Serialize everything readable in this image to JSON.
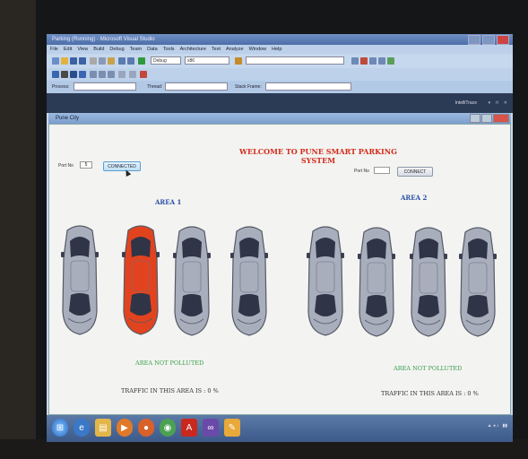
{
  "vs": {
    "title": "Parking (Running) - Microsoft Visual Studio",
    "menu": [
      "File",
      "Edit",
      "View",
      "Build",
      "Debug",
      "Team",
      "Data",
      "Tools",
      "Architecture",
      "Test",
      "Analyze",
      "Window",
      "Help"
    ],
    "config_value": "Debug",
    "platform_value": "x86",
    "process_label": "Process:",
    "thread_label": "Thread:",
    "stack_frame_label": "Stack Frame:",
    "intellitrace_label": "IntelliTrace"
  },
  "app": {
    "window_title": "Pune City",
    "welcome": "WELCOME TO PUNE SMART PARKING SYSTEM",
    "left_port_label": "Port No",
    "left_port_value": "5",
    "left_connect_label": "CONNECTED",
    "right_port_label": "Port No",
    "right_port_value": "",
    "right_connect_label": "CONNECT",
    "area1": {
      "title": "AREA 1",
      "status": "AREA NOT POLLUTED",
      "traffic": "TRAFFIC IN THIS AREA IS : 0 %",
      "slots": [
        "empty",
        "occupied",
        "empty",
        "empty"
      ]
    },
    "area2": {
      "title": "AREA 2",
      "status": "AREA NOT POLLUTED",
      "traffic": "TRAFFIC IN THIS AREA IS : 0 %",
      "slots": [
        "empty",
        "empty",
        "empty",
        "empty"
      ]
    }
  },
  "colors": {
    "car_empty": "#a9aebd",
    "car_occupied": "#e2431f",
    "welcome": "#d22b1a",
    "area_title": "#2a4fa8",
    "status_ok": "#3aa04a"
  },
  "taskbar": {
    "items": [
      "start-orb-icon",
      "ie-icon",
      "explorer-icon",
      "media-player-icon",
      "firefox-icon",
      "chrome-icon",
      "acrobat-icon",
      "vs-icon",
      "paint-icon"
    ]
  }
}
